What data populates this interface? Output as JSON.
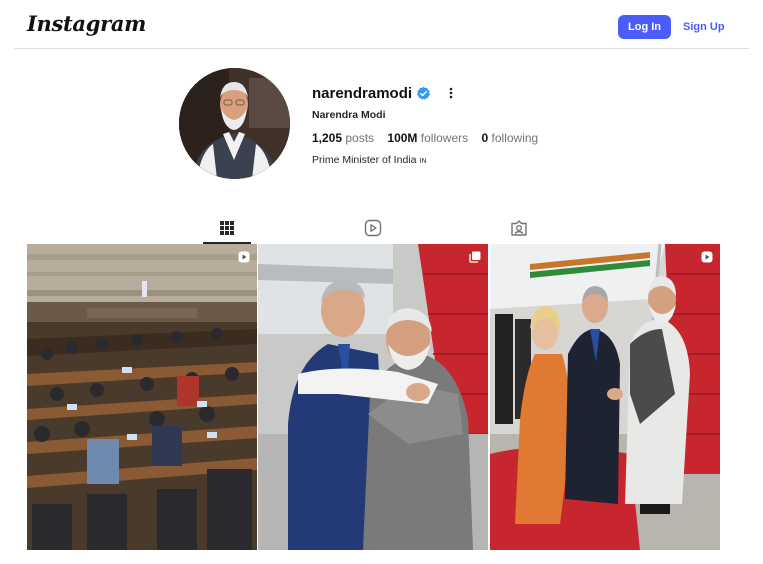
{
  "header": {
    "logo_text": "Instagram",
    "login_label": "Log In",
    "signup_label": "Sign Up"
  },
  "profile": {
    "username": "narendramodi",
    "full_name": "Narendra Modi",
    "verified": true,
    "stats": {
      "posts_count": "1,205",
      "posts_label": "posts",
      "followers_count": "100M",
      "followers_label": "followers",
      "following_count": "0",
      "following_label": "following"
    },
    "bio": "Prime Minister of India",
    "bio_flag": "IN"
  },
  "tabs": [
    {
      "icon": "grid-icon",
      "active": true
    },
    {
      "icon": "reels-icon",
      "active": false
    },
    {
      "icon": "tagged-icon",
      "active": false
    }
  ],
  "posts": [
    {
      "badge": "reel-icon"
    },
    {
      "badge": "carousel-icon"
    },
    {
      "badge": "reel-icon"
    }
  ],
  "colors": {
    "accent": "#4a5df9",
    "verified": "#3897f0",
    "carpet": "#c8262e"
  }
}
